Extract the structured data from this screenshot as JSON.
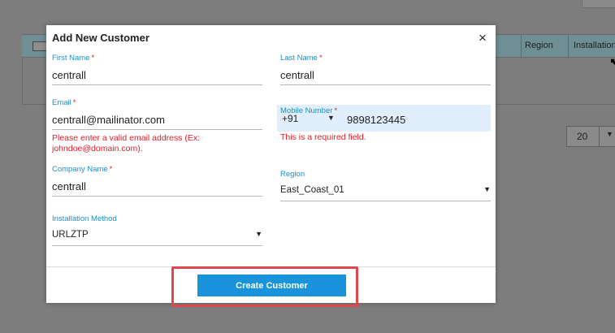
{
  "background": {
    "table_columns": [
      "Region",
      "Installation"
    ],
    "page_size": "20"
  },
  "modal": {
    "title": "Add New Customer",
    "close_symbol": "×",
    "fields": {
      "first_name": {
        "label": "First Name",
        "value": "centrall"
      },
      "last_name": {
        "label": "Last Name",
        "value": "centrall"
      },
      "email": {
        "label": "Email",
        "value": "centrall@mailinator.com",
        "error_line1": "Please enter a valid email address (Ex:",
        "error_line2": "johndoe@domain.com)."
      },
      "mobile": {
        "label": "Mobile Number",
        "country_code": "+91",
        "value": "9898123445",
        "error": "This is a required field."
      },
      "company_name": {
        "label": "Company Name",
        "value": "centrall"
      },
      "region": {
        "label": "Region",
        "value": "East_Coast_01"
      },
      "installation_method": {
        "label": "Installation Method",
        "value": "URLZTP"
      }
    },
    "required_marker": "*",
    "submit_label": "Create Customer"
  },
  "colors": {
    "accent": "#1a93dd",
    "label": "#1a8fc8",
    "error": "#e0202a",
    "highlight": "#e0474c"
  }
}
